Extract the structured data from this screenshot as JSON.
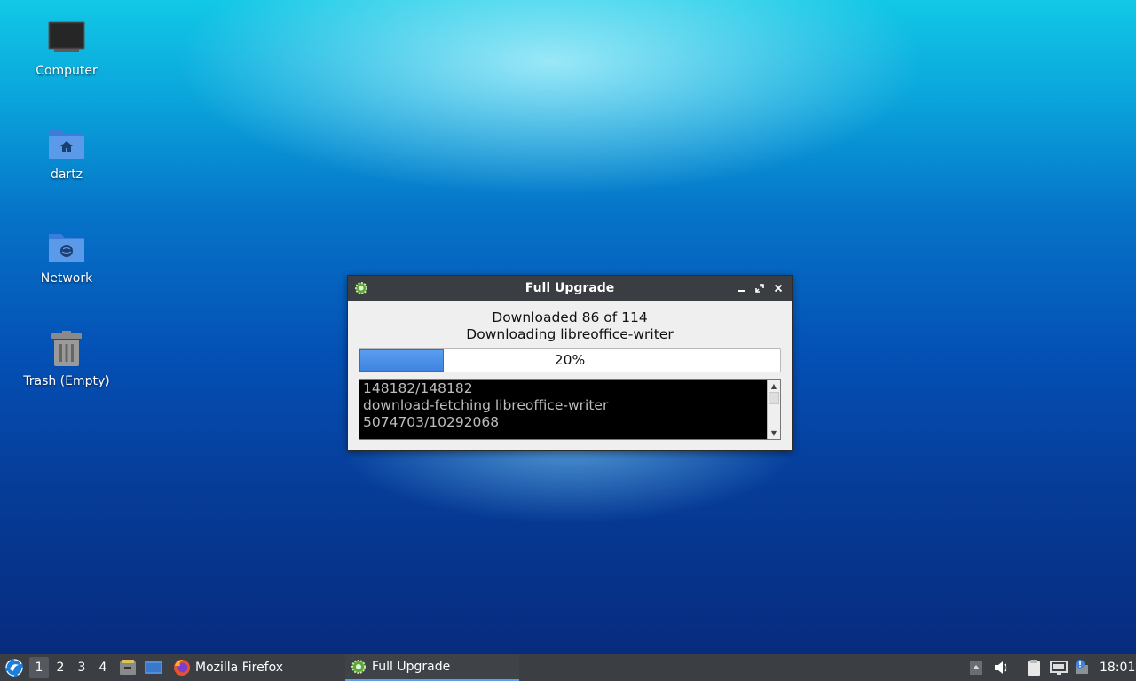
{
  "desktop": {
    "icons": [
      {
        "label": "Computer"
      },
      {
        "label": "dartz"
      },
      {
        "label": "Network"
      },
      {
        "label": "Trash (Empty)"
      }
    ]
  },
  "window": {
    "title": "Full Upgrade",
    "status_line1": "Downloaded 86 of 114",
    "status_line2": "Downloading libreoffice-writer",
    "progress": {
      "percent": 20,
      "label": "20%"
    },
    "log_lines": [
      "148182/148182",
      "download-fetching libreoffice-writer",
      "5074703/10292068"
    ],
    "controls": {
      "minimize_icon": "minimize-icon",
      "maximize_icon": "maximize-icon",
      "close_icon": "close-icon"
    }
  },
  "taskbar": {
    "workspaces": [
      "1",
      "2",
      "3",
      "4"
    ],
    "active_workspace": "1",
    "tasks": [
      {
        "label": "Mozilla Firefox",
        "icon": "firefox-icon"
      },
      {
        "label": "Full Upgrade",
        "icon": "gear-icon"
      }
    ],
    "clock": "18:01"
  },
  "colors": {
    "accent": "#3f84e0",
    "titlebar": "#3a3d42",
    "taskbar": "#3b3e43"
  }
}
